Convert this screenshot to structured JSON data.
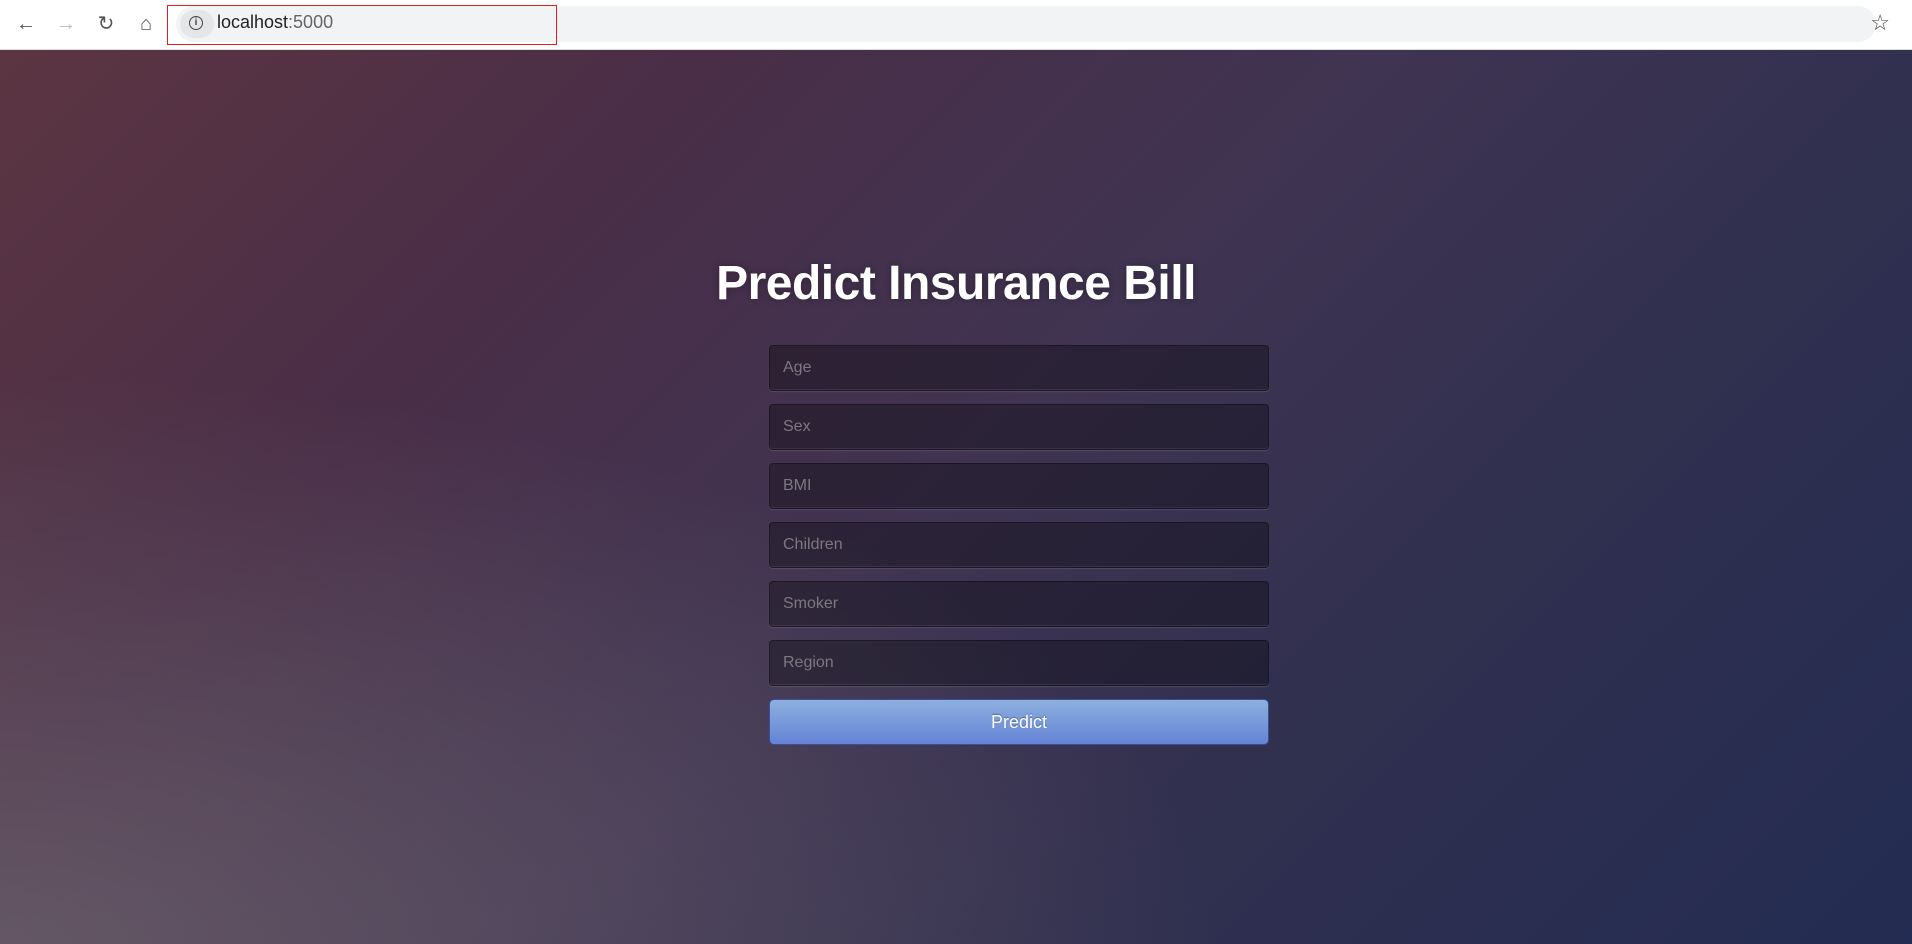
{
  "browser": {
    "url_host": "localhost",
    "url_port": ":5000"
  },
  "page": {
    "title": "Predict Insurance Bill",
    "fields": [
      {
        "placeholder": "Age",
        "value": ""
      },
      {
        "placeholder": "Sex",
        "value": ""
      },
      {
        "placeholder": "BMI",
        "value": ""
      },
      {
        "placeholder": "Children",
        "value": ""
      },
      {
        "placeholder": "Smoker",
        "value": ""
      },
      {
        "placeholder": "Region",
        "value": ""
      }
    ],
    "submit_label": "Predict"
  }
}
